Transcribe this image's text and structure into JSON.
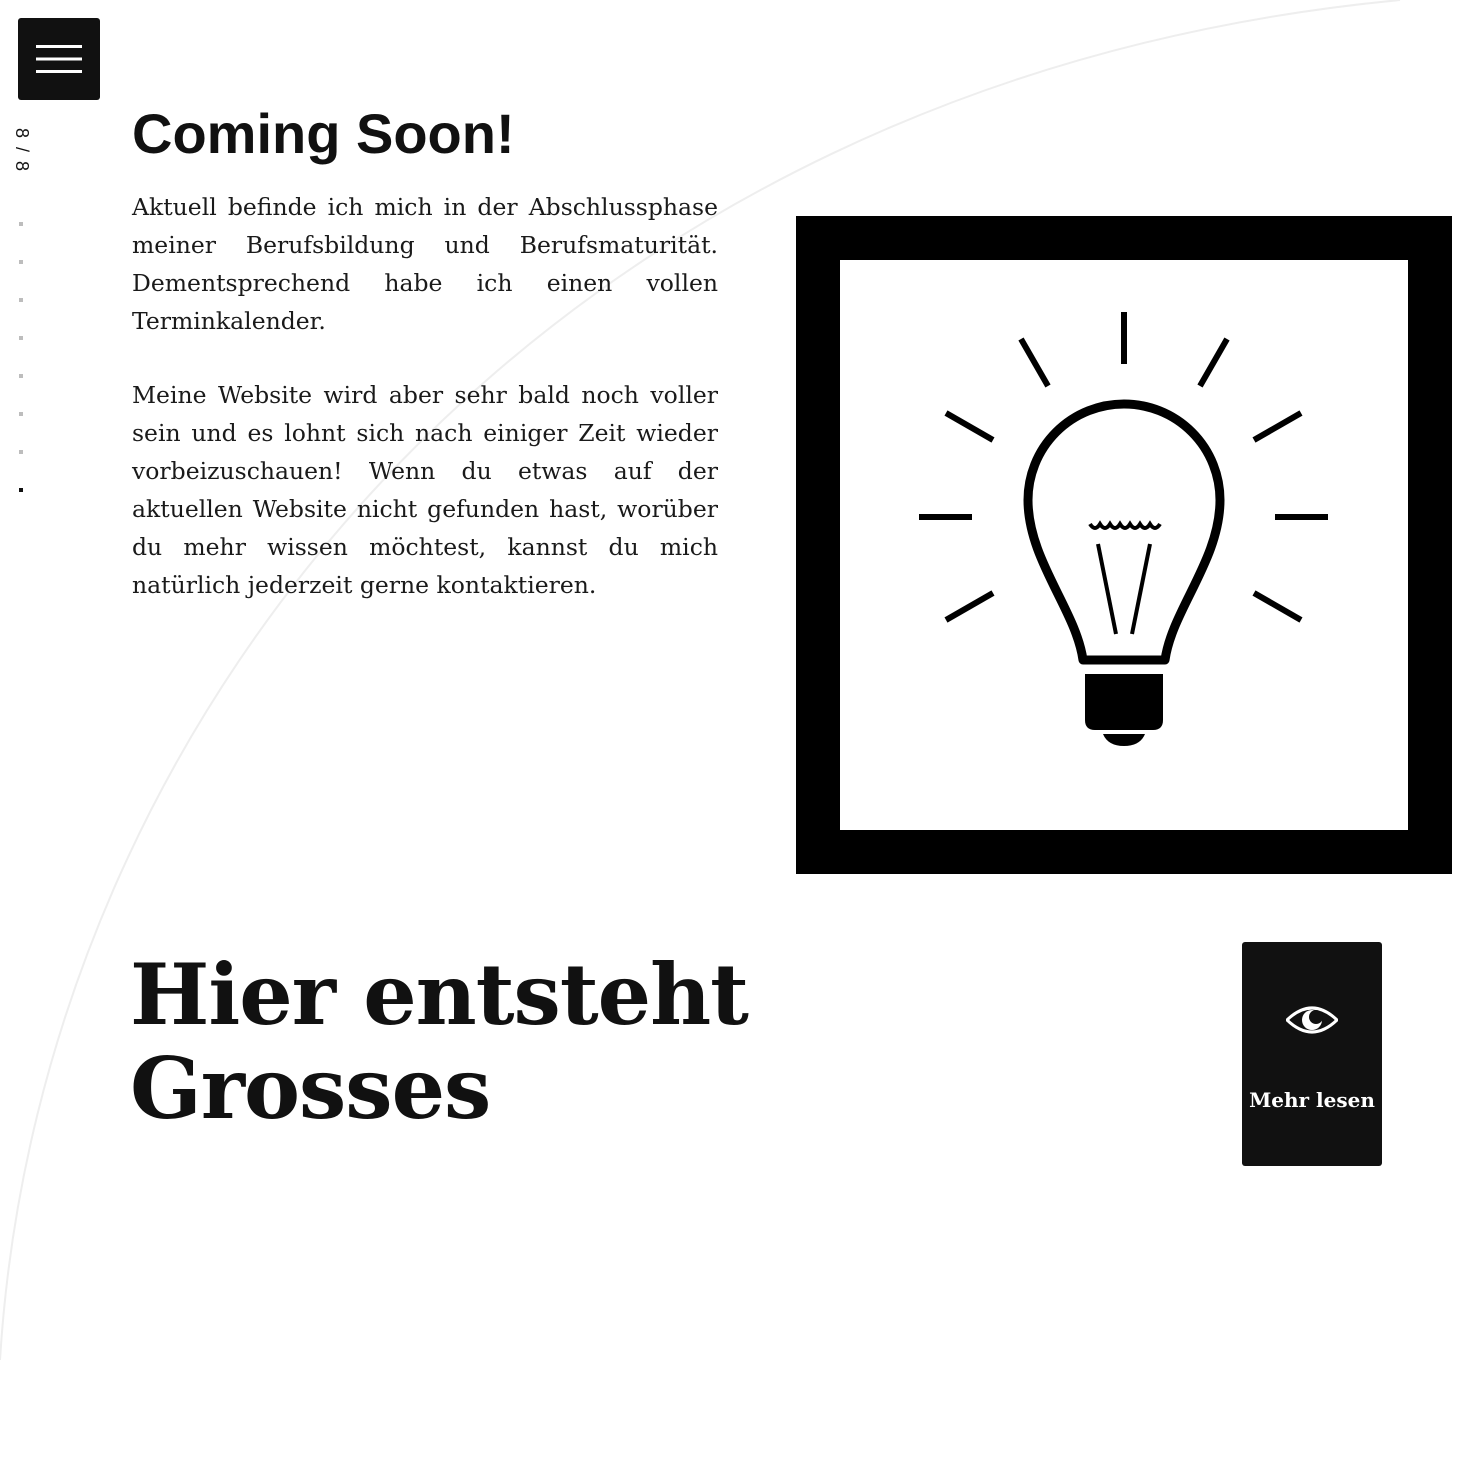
{
  "nav": {
    "menu_icon": "hamburger-icon",
    "counter": "8 / 8",
    "slides": [
      {
        "active": false
      },
      {
        "active": false
      },
      {
        "active": false
      },
      {
        "active": false
      },
      {
        "active": false
      },
      {
        "active": false
      },
      {
        "active": false
      },
      {
        "active": true
      }
    ]
  },
  "section": {
    "title": "Coming Soon!",
    "paragraphs": [
      "Aktuell befinde ich mich in der Abschlussphase meiner Berufsbildung und Berufsmaturität. Dementsprechend habe ich einen vollen Terminkalender.",
      "Meine Website wird aber sehr bald noch voller sein und es lohnt sich nach einiger Zeit wieder vorbeizuschauen! Wenn du etwas auf der aktuellen Website nicht gefunden hast, worüber du mehr wissen möchtest, kannst du mich natürlich jederzeit gerne kontaktieren."
    ],
    "image_icon": "lightbulb-icon"
  },
  "hero": {
    "line1": "Hier entsteht",
    "line2": "Grosses"
  },
  "read_more": {
    "label": "Mehr lesen",
    "icon": "eye-icon"
  },
  "colors": {
    "background": "#ffffff",
    "text": "#111111",
    "button_bg": "#111111",
    "inactive_dot": "#bdbdbd"
  }
}
